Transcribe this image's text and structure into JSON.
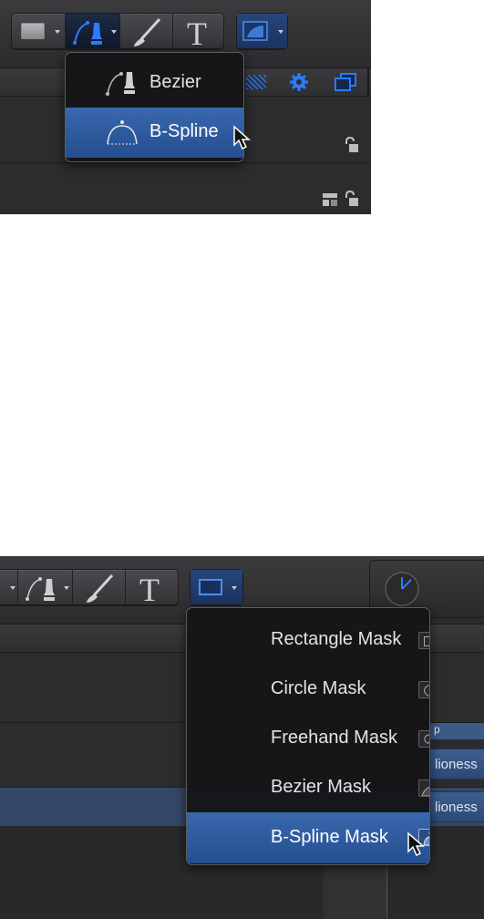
{
  "panel1": {
    "menu": {
      "items": [
        {
          "label": "Bezier",
          "icon": "bezier-pen-icon",
          "highlighted": false
        },
        {
          "label": "B-Spline",
          "icon": "bspline-curve-icon",
          "highlighted": true
        }
      ]
    },
    "toolbar": {
      "tools": [
        "rectangle-tool-icon",
        "pen-tool-icon",
        "paint-brush-icon",
        "text-tool-icon",
        "mask-tool-icon"
      ],
      "text_tool_glyph": "T"
    }
  },
  "panel2": {
    "menu": {
      "items": [
        {
          "label": "Rectangle Mask",
          "icon": "rectangle-mask-icon",
          "highlighted": false
        },
        {
          "label": "Circle Mask",
          "icon": "circle-mask-icon",
          "highlighted": false
        },
        {
          "label": "Freehand Mask",
          "icon": "freehand-mask-icon",
          "highlighted": false
        },
        {
          "label": "Bezier Mask",
          "icon": "bezier-mask-icon",
          "highlighted": false
        },
        {
          "label": "B-Spline Mask",
          "icon": "bspline-mask-icon",
          "highlighted": true
        }
      ]
    },
    "toolbar": {
      "text_tool_glyph": "T"
    },
    "layers": [
      "lioness",
      "lioness"
    ],
    "header_fragment": "p"
  },
  "colors": {
    "highlight": "#2f5ea3",
    "tool_active": "#2b7bff",
    "menu_bg": "#161618",
    "ui_bg": "#2a2a2c"
  }
}
